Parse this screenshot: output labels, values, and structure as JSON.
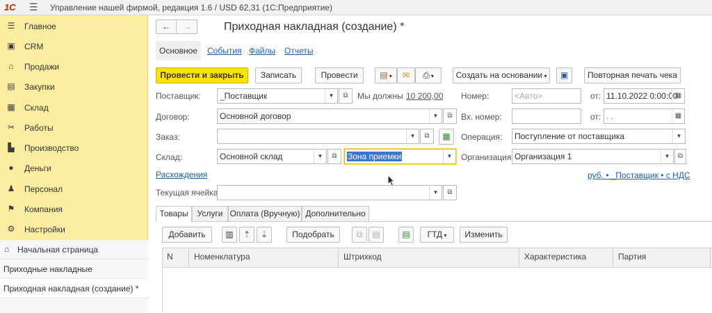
{
  "app": {
    "logo": "1С",
    "title": "Управление нашей фирмой, редакция 1.6 / USD 62,31  (1С:Предприятие)"
  },
  "sidebar": {
    "sections": [
      {
        "label": "Главное",
        "icon": "menu-lines-icon"
      },
      {
        "label": "CRM",
        "icon": "crm-card-icon"
      },
      {
        "label": "Продажи",
        "icon": "sales-basket-icon"
      },
      {
        "label": "Закупки",
        "icon": "purchases-cart-icon"
      },
      {
        "label": "Склад",
        "icon": "warehouse-grid-icon"
      },
      {
        "label": "Работы",
        "icon": "tools-icon"
      },
      {
        "label": "Производство",
        "icon": "factory-icon"
      },
      {
        "label": "Деньги",
        "icon": "money-coin-icon"
      },
      {
        "label": "Персонал",
        "icon": "person-icon"
      },
      {
        "label": "Компания",
        "icon": "flag-icon"
      },
      {
        "label": "Настройки",
        "icon": "gear-icon"
      }
    ],
    "history": [
      {
        "label": "Начальная страница",
        "icon": "home-icon"
      },
      {
        "label": "Приходные накладные"
      },
      {
        "label": "Приходная накладная (создание) *"
      }
    ]
  },
  "form": {
    "title": "Приходная накладная (создание) *",
    "tabs": [
      "Основное",
      "События",
      "Файлы",
      "Отчеты"
    ],
    "toolbar": {
      "post_close": "Провести и закрыть",
      "save": "Записать",
      "post": "Провести",
      "create_based": "Создать на основании",
      "reprint": "Повторная печать чека"
    },
    "fields": {
      "supplier_label": "Поставщик:",
      "supplier": "_Поставщик",
      "we_owe_label": "Мы должны",
      "we_owe": "10 200,00",
      "number_label": "Номер:",
      "number_placeholder": "<Авто>",
      "from_label": "от:",
      "date": "11.10.2022  0:00:00",
      "contract_label": "Договор:",
      "contract": "Основной договор",
      "in_number_label": "Вх. номер:",
      "in_number": "",
      "from2_label": "от:",
      "in_date": "  .  .",
      "order_label": "Заказ:",
      "order": "",
      "operation_label": "Операция:",
      "operation": "Поступление от поставщика",
      "warehouse_label": "Склад:",
      "warehouse": "Основной склад",
      "zone": "Зона приемки",
      "org_label": "Организация:",
      "org": "Организация 1",
      "discrepancies": "Расхождения",
      "price_info": "руб. • _Поставщик • с НДС",
      "cell_label": "Текущая ячейка:",
      "cell": ""
    },
    "detail_tabs": [
      "Товары",
      "Услуги",
      "Оплата (Вручную)",
      "Дополнительно"
    ],
    "table_toolbar": {
      "add": "Добавить",
      "pick": "Подобрать",
      "gtd": "ГТД",
      "change": "Изменить"
    },
    "columns": [
      "N",
      "Номенклатура",
      "Штрихкод",
      "Характеристика",
      "Партия"
    ]
  }
}
